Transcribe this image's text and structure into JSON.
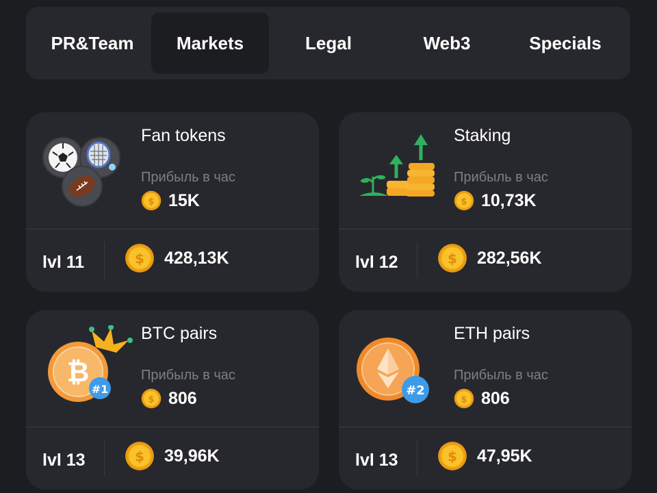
{
  "tabs": [
    {
      "label": "PR&Team",
      "active": false
    },
    {
      "label": "Markets",
      "active": true
    },
    {
      "label": "Legal",
      "active": false
    },
    {
      "label": "Web3",
      "active": false
    },
    {
      "label": "Specials",
      "active": false
    }
  ],
  "profit_label": "Прибыль в час",
  "cards": [
    {
      "title": "Fan tokens",
      "profit": "15K",
      "level": "lvl 11",
      "cost": "428,13K",
      "icon": "sports-balls-icon"
    },
    {
      "title": "Staking",
      "profit": "10,73K",
      "level": "lvl 12",
      "cost": "282,56K",
      "icon": "staking-growth-icon"
    },
    {
      "title": "BTC pairs",
      "profit": "806",
      "level": "lvl 13",
      "cost": "39,96K",
      "icon": "btc-crown-icon",
      "badge": "#1"
    },
    {
      "title": "ETH pairs",
      "profit": "806",
      "level": "lvl 13",
      "cost": "47,95K",
      "icon": "eth-coin-icon",
      "badge": "#2"
    }
  ],
  "colors": {
    "background": "#1c1d21",
    "card": "#27282d",
    "muted_text": "#7d7f86",
    "coin": "#f5b21c"
  }
}
